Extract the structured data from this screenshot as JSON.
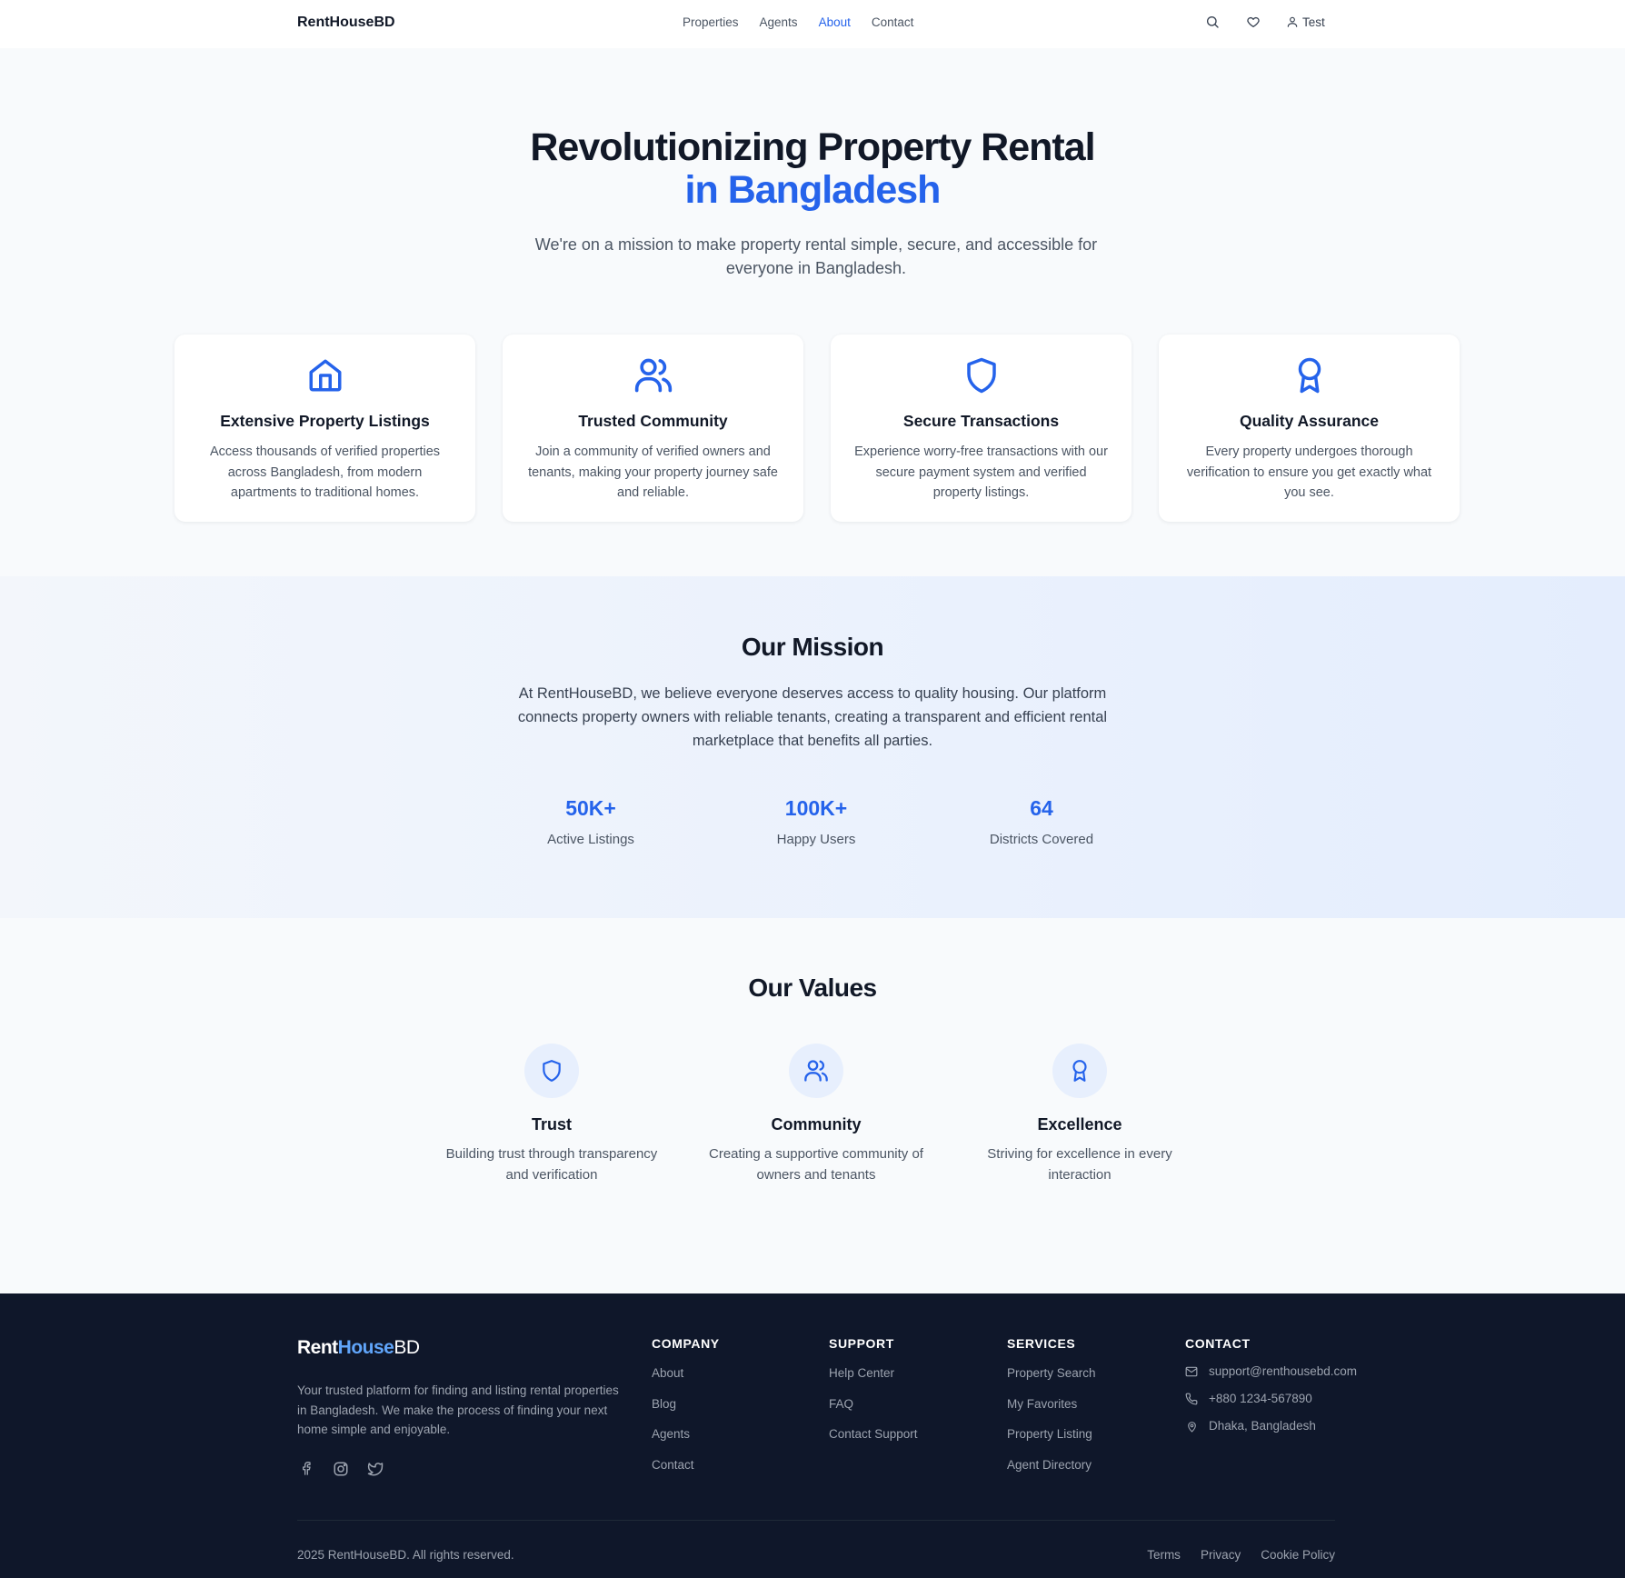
{
  "nav": {
    "brand": "RentHouseBD",
    "links": [
      "Properties",
      "Agents",
      "About",
      "Contact"
    ],
    "active": "About",
    "user_label": "Test",
    "icons": [
      "search-icon",
      "heart-icon",
      "user-icon"
    ]
  },
  "hero": {
    "title_line1": "Revolutionizing Property Rental",
    "title_line2": "in Bangladesh",
    "subtitle": "We're on a mission to make property rental simple, secure, and accessible for everyone in Bangladesh."
  },
  "features": [
    {
      "icon": "home-icon",
      "title": "Extensive Property Listings",
      "desc": "Access thousands of verified properties across Bangladesh, from modern apartments to traditional homes."
    },
    {
      "icon": "users-icon",
      "title": "Trusted Community",
      "desc": "Join a community of verified owners and tenants, making your property journey safe and reliable."
    },
    {
      "icon": "shield-icon",
      "title": "Secure Transactions",
      "desc": "Experience worry-free transactions with our secure payment system and verified property listings."
    },
    {
      "icon": "award-icon",
      "title": "Quality Assurance",
      "desc": "Every property undergoes thorough verification to ensure you get exactly what you see."
    }
  ],
  "mission": {
    "title": "Our Mission",
    "desc": "At RentHouseBD, we believe everyone deserves access to quality housing. Our platform connects property owners with reliable tenants, creating a transparent and efficient rental marketplace that benefits all parties.",
    "stats": [
      {
        "value": "50K+",
        "label": "Active Listings"
      },
      {
        "value": "100K+",
        "label": "Happy Users"
      },
      {
        "value": "64",
        "label": "Districts Covered"
      }
    ]
  },
  "values": {
    "title": "Our Values",
    "items": [
      {
        "icon": "shield-icon",
        "title": "Trust",
        "desc": "Building trust through transparency and verification"
      },
      {
        "icon": "users-icon",
        "title": "Community",
        "desc": "Creating a supportive community of owners and tenants"
      },
      {
        "icon": "award-icon",
        "title": "Excellence",
        "desc": "Striving for excellence in every interaction"
      }
    ]
  },
  "footer": {
    "brand_part1": "Rent",
    "brand_part2": "House",
    "brand_part3": "BD",
    "desc": "Your trusted platform for finding and listing rental properties in Bangladesh. We make the process of finding your next home simple and enjoyable.",
    "social": [
      "facebook-icon",
      "instagram-icon",
      "twitter-icon"
    ],
    "company": {
      "heading": "COMPANY",
      "links": [
        "About",
        "Blog",
        "Agents",
        "Contact"
      ]
    },
    "support": {
      "heading": "SUPPORT",
      "links": [
        "Help Center",
        "FAQ",
        "Contact Support"
      ]
    },
    "services": {
      "heading": "SERVICES",
      "links": [
        "Property Search",
        "My Favorites",
        "Property Listing",
        "Agent Directory"
      ]
    },
    "contact": {
      "heading": "CONTACT",
      "email": "support@renthousebd.com",
      "phone": "+880 1234-567890",
      "address": "Dhaka, Bangladesh"
    },
    "copyright": "2025 RentHouseBD. All rights reserved.",
    "legal": [
      "Terms",
      "Privacy",
      "Cookie Policy"
    ]
  },
  "colors": {
    "accent": "#2563eb",
    "footer_bg": "#0f172a",
    "page_bg": "#f8fafc"
  }
}
